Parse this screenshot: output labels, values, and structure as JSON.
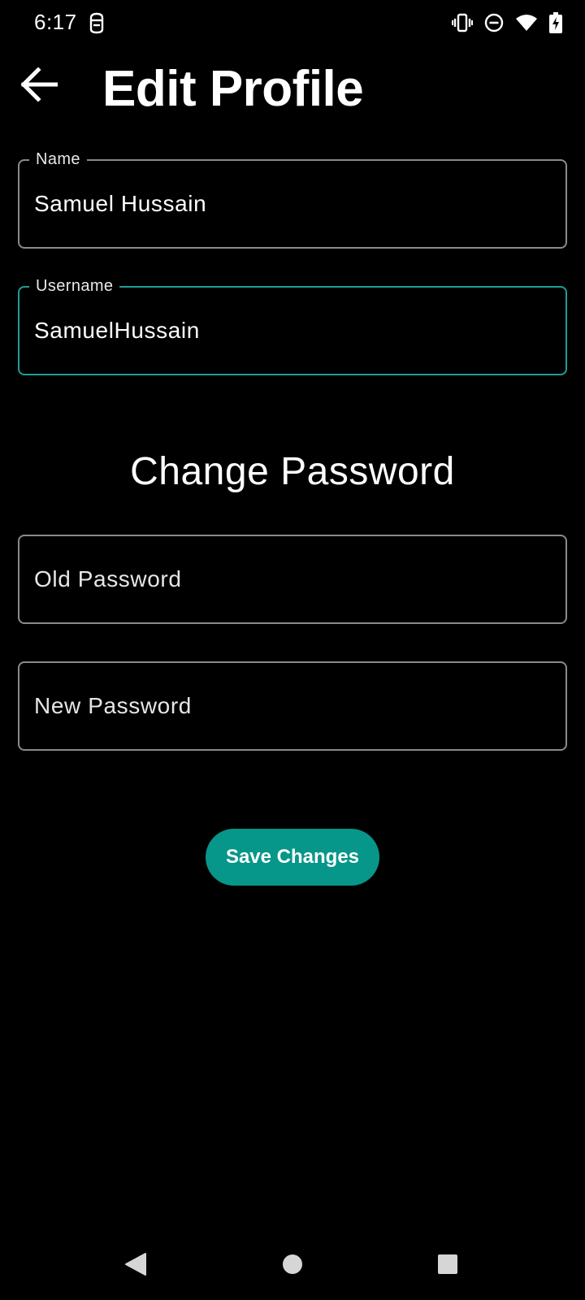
{
  "status_bar": {
    "time": "6:17",
    "left_icon": "notification-app-icon",
    "right_icons": [
      "vibrate-icon",
      "do-not-disturb-icon",
      "wifi-icon",
      "battery-charging-icon"
    ]
  },
  "app_bar": {
    "back_icon": "arrow-back-icon",
    "title": "Edit Profile"
  },
  "form": {
    "name": {
      "label": "Name",
      "value": "Samuel Hussain"
    },
    "username": {
      "label": "Username",
      "value": "SamuelHussain"
    },
    "change_password_heading": "Change Password",
    "old_password": {
      "placeholder": "Old Password",
      "value": ""
    },
    "new_password": {
      "placeholder": "New Password",
      "value": ""
    },
    "save_label": "Save Changes"
  },
  "nav_bar": {
    "icons": [
      "back-triangle-icon",
      "home-circle-icon",
      "recents-square-icon"
    ]
  },
  "colors": {
    "background": "#000000",
    "accent": "#07968a",
    "focused_outline": "#1e9e94",
    "outline": "#8a8a8a",
    "text": "#ffffff"
  }
}
